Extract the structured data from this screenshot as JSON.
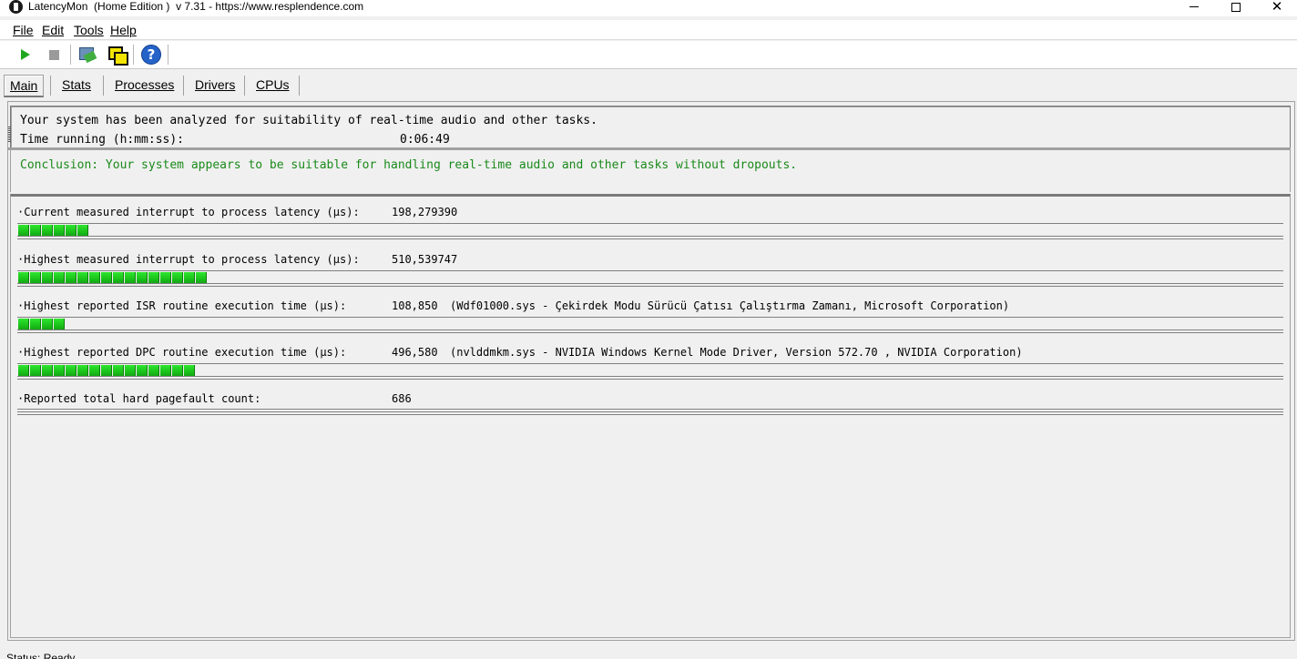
{
  "window": {
    "title": "LatencyMon  (Home Edition )  v 7.31 - https://www.resplendence.com",
    "close_glyph": "✕"
  },
  "menu": {
    "file": "File",
    "edit": "Edit",
    "tools": "Tools",
    "help": "Help"
  },
  "toolbar": {
    "icons": [
      "play-icon",
      "stop-icon",
      "cleanup-icon",
      "windows-icon",
      "help-icon"
    ],
    "help_glyph": "?"
  },
  "tabs": {
    "main": "Main",
    "stats": "Stats",
    "processes": "Processes",
    "drivers": "Drivers",
    "cpus": "CPUs",
    "active": "Main"
  },
  "summary": {
    "line1": "Your system has been analyzed for suitability of real-time audio and other tasks.",
    "time_label": "Time running (h:mm:ss):",
    "time_value": "0:06:49",
    "conclusion": "Conclusion: Your system appears to be suitable for handling real-time audio and other tasks without dropouts.",
    "conclusion_color": "#1a8a1a"
  },
  "metrics": [
    {
      "label": "·Current measured interrupt to process latency (µs):",
      "value": "198,279390",
      "extra": "",
      "bar_segments": 6
    },
    {
      "label": "·Highest measured interrupt to process latency (µs):",
      "value": "510,539747",
      "extra": "",
      "bar_segments": 16
    },
    {
      "label": "·Highest reported ISR routine execution time (µs):",
      "value": "108,850",
      "extra": "(Wdf01000.sys - Çekirdek Modu Sürücü Çatısı Çalıştırma Zamanı, Microsoft Corporation)",
      "bar_segments": 4
    },
    {
      "label": "·Highest reported DPC routine execution time (µs):",
      "value": "496,580",
      "extra": "(nvlddmkm.sys - NVIDIA Windows Kernel Mode Driver, Version 572.70 , NVIDIA Corporation)",
      "bar_segments": 15
    },
    {
      "label": "·Reported total hard pagefault count:",
      "value": "686",
      "extra": "",
      "bar_segments": 0
    }
  ],
  "colors": {
    "bar_green": "#1ac01a",
    "panel_bg": "#f0f0f0"
  },
  "status": "Status: Ready"
}
